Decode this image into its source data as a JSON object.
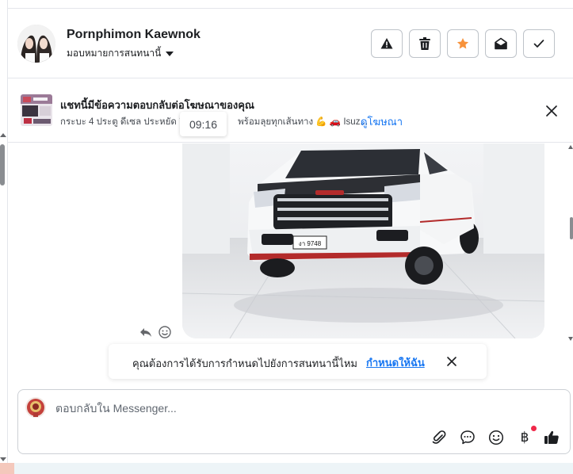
{
  "header": {
    "contact_name": "Pornphimon Kaewnok",
    "assign_label": "มอบหมายการสนทนานี้",
    "buttons": [
      {
        "icon": "warning-icon",
        "name": "spam-button"
      },
      {
        "icon": "trash-icon",
        "name": "delete-button"
      },
      {
        "icon": "star-icon",
        "name": "star-button"
      },
      {
        "icon": "envelope-open-icon",
        "name": "mark-unread-button"
      },
      {
        "icon": "checkmark-icon",
        "name": "mark-done-button"
      }
    ],
    "star_color": "#f7923b"
  },
  "ad_banner": {
    "title": "แชทนี้มีข้อความตอบกลับต่อโฆษณาของคุณ",
    "description": "กระบะ 4 ประตู ดีเซล ประหยัด อี",
    "description_tail": "พร้อมลุยทุกเส้นทาง 💪 🚗 Isuz...",
    "link": "ดูโฆษณา"
  },
  "chat": {
    "timestamp": "09:16",
    "plate_text": "งา 9748"
  },
  "assign_prompt": {
    "question": "คุณต้องการได้รับการกำหนดไปยังการสนทนานี้ไหม",
    "action": "กำหนดให้ฉัน"
  },
  "composer": {
    "placeholder": "ตอบกลับใน Messenger...",
    "tools": [
      "paperclip-icon",
      "chat-bubble-icon",
      "emoji-icon",
      "baht-icon",
      "thumbs-up-icon"
    ],
    "baht_symbol": "฿"
  },
  "colors": {
    "accent": "#1877f2",
    "border": "#bec3c9",
    "notification": "#f02849"
  }
}
